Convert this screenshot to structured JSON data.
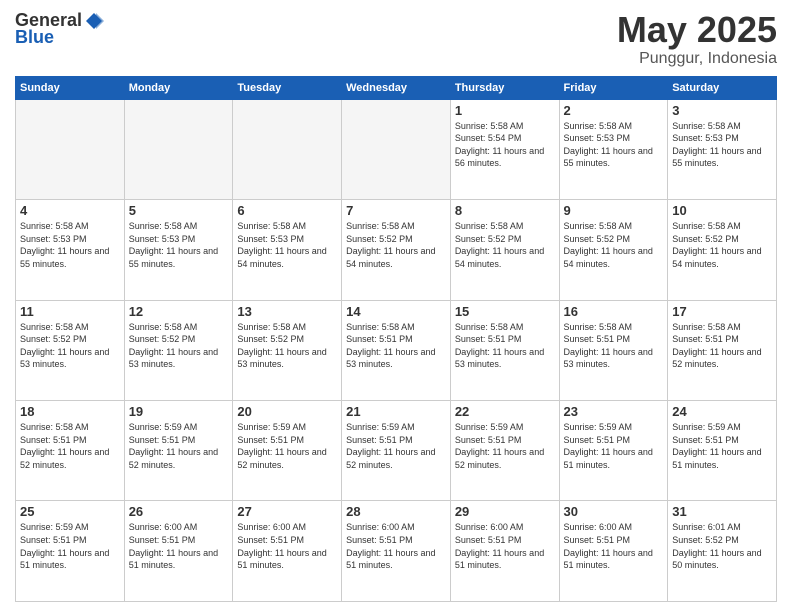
{
  "header": {
    "logo_general": "General",
    "logo_blue": "Blue",
    "month": "May 2025",
    "location": "Punggur, Indonesia"
  },
  "weekdays": [
    "Sunday",
    "Monday",
    "Tuesday",
    "Wednesday",
    "Thursday",
    "Friday",
    "Saturday"
  ],
  "weeks": [
    [
      {
        "day": "",
        "info": ""
      },
      {
        "day": "",
        "info": ""
      },
      {
        "day": "",
        "info": ""
      },
      {
        "day": "",
        "info": ""
      },
      {
        "day": "1",
        "info": "Sunrise: 5:58 AM\nSunset: 5:54 PM\nDaylight: 11 hours and 56 minutes."
      },
      {
        "day": "2",
        "info": "Sunrise: 5:58 AM\nSunset: 5:53 PM\nDaylight: 11 hours and 55 minutes."
      },
      {
        "day": "3",
        "info": "Sunrise: 5:58 AM\nSunset: 5:53 PM\nDaylight: 11 hours and 55 minutes."
      }
    ],
    [
      {
        "day": "4",
        "info": "Sunrise: 5:58 AM\nSunset: 5:53 PM\nDaylight: 11 hours and 55 minutes."
      },
      {
        "day": "5",
        "info": "Sunrise: 5:58 AM\nSunset: 5:53 PM\nDaylight: 11 hours and 55 minutes."
      },
      {
        "day": "6",
        "info": "Sunrise: 5:58 AM\nSunset: 5:53 PM\nDaylight: 11 hours and 54 minutes."
      },
      {
        "day": "7",
        "info": "Sunrise: 5:58 AM\nSunset: 5:52 PM\nDaylight: 11 hours and 54 minutes."
      },
      {
        "day": "8",
        "info": "Sunrise: 5:58 AM\nSunset: 5:52 PM\nDaylight: 11 hours and 54 minutes."
      },
      {
        "day": "9",
        "info": "Sunrise: 5:58 AM\nSunset: 5:52 PM\nDaylight: 11 hours and 54 minutes."
      },
      {
        "day": "10",
        "info": "Sunrise: 5:58 AM\nSunset: 5:52 PM\nDaylight: 11 hours and 54 minutes."
      }
    ],
    [
      {
        "day": "11",
        "info": "Sunrise: 5:58 AM\nSunset: 5:52 PM\nDaylight: 11 hours and 53 minutes."
      },
      {
        "day": "12",
        "info": "Sunrise: 5:58 AM\nSunset: 5:52 PM\nDaylight: 11 hours and 53 minutes."
      },
      {
        "day": "13",
        "info": "Sunrise: 5:58 AM\nSunset: 5:52 PM\nDaylight: 11 hours and 53 minutes."
      },
      {
        "day": "14",
        "info": "Sunrise: 5:58 AM\nSunset: 5:51 PM\nDaylight: 11 hours and 53 minutes."
      },
      {
        "day": "15",
        "info": "Sunrise: 5:58 AM\nSunset: 5:51 PM\nDaylight: 11 hours and 53 minutes."
      },
      {
        "day": "16",
        "info": "Sunrise: 5:58 AM\nSunset: 5:51 PM\nDaylight: 11 hours and 53 minutes."
      },
      {
        "day": "17",
        "info": "Sunrise: 5:58 AM\nSunset: 5:51 PM\nDaylight: 11 hours and 52 minutes."
      }
    ],
    [
      {
        "day": "18",
        "info": "Sunrise: 5:58 AM\nSunset: 5:51 PM\nDaylight: 11 hours and 52 minutes."
      },
      {
        "day": "19",
        "info": "Sunrise: 5:59 AM\nSunset: 5:51 PM\nDaylight: 11 hours and 52 minutes."
      },
      {
        "day": "20",
        "info": "Sunrise: 5:59 AM\nSunset: 5:51 PM\nDaylight: 11 hours and 52 minutes."
      },
      {
        "day": "21",
        "info": "Sunrise: 5:59 AM\nSunset: 5:51 PM\nDaylight: 11 hours and 52 minutes."
      },
      {
        "day": "22",
        "info": "Sunrise: 5:59 AM\nSunset: 5:51 PM\nDaylight: 11 hours and 52 minutes."
      },
      {
        "day": "23",
        "info": "Sunrise: 5:59 AM\nSunset: 5:51 PM\nDaylight: 11 hours and 51 minutes."
      },
      {
        "day": "24",
        "info": "Sunrise: 5:59 AM\nSunset: 5:51 PM\nDaylight: 11 hours and 51 minutes."
      }
    ],
    [
      {
        "day": "25",
        "info": "Sunrise: 5:59 AM\nSunset: 5:51 PM\nDaylight: 11 hours and 51 minutes."
      },
      {
        "day": "26",
        "info": "Sunrise: 6:00 AM\nSunset: 5:51 PM\nDaylight: 11 hours and 51 minutes."
      },
      {
        "day": "27",
        "info": "Sunrise: 6:00 AM\nSunset: 5:51 PM\nDaylight: 11 hours and 51 minutes."
      },
      {
        "day": "28",
        "info": "Sunrise: 6:00 AM\nSunset: 5:51 PM\nDaylight: 11 hours and 51 minutes."
      },
      {
        "day": "29",
        "info": "Sunrise: 6:00 AM\nSunset: 5:51 PM\nDaylight: 11 hours and 51 minutes."
      },
      {
        "day": "30",
        "info": "Sunrise: 6:00 AM\nSunset: 5:51 PM\nDaylight: 11 hours and 51 minutes."
      },
      {
        "day": "31",
        "info": "Sunrise: 6:01 AM\nSunset: 5:52 PM\nDaylight: 11 hours and 50 minutes."
      }
    ]
  ]
}
